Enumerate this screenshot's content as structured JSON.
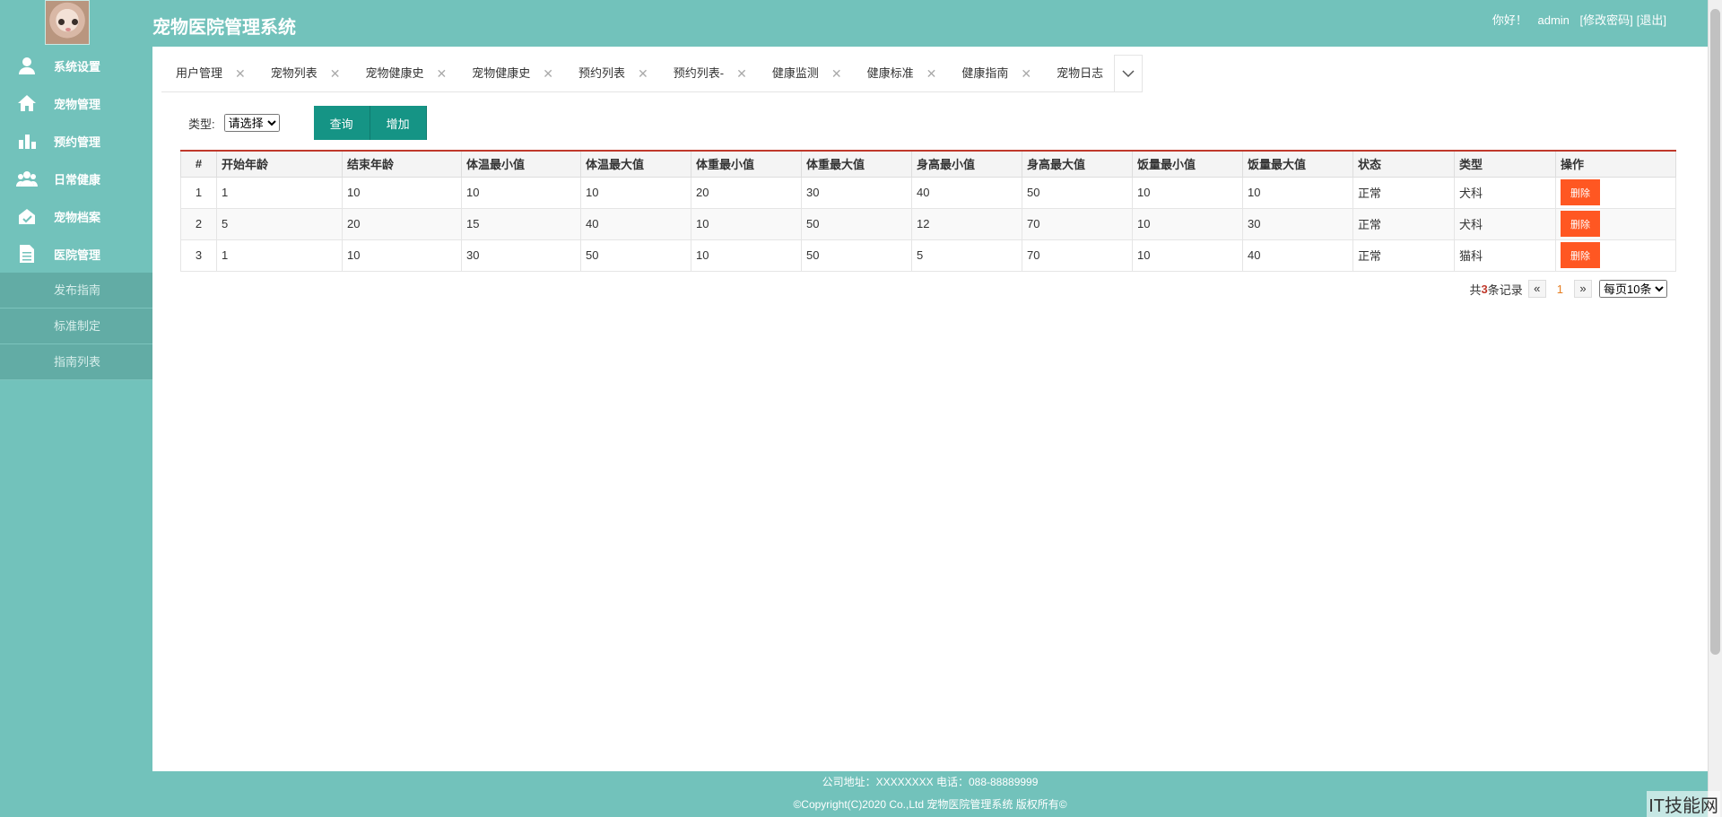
{
  "header": {
    "title": "宠物医院管理系统",
    "greeting": "你好！",
    "username": "admin",
    "change_password": "[修改密码]",
    "logout": "[退出]"
  },
  "sidebar": {
    "items": [
      {
        "label": "系统设置",
        "icon": "user-icon"
      },
      {
        "label": "宠物管理",
        "icon": "home-icon"
      },
      {
        "label": "预约管理",
        "icon": "bar-chart-icon"
      },
      {
        "label": "日常健康",
        "icon": "group-icon"
      },
      {
        "label": "宠物档案",
        "icon": "archive-icon"
      },
      {
        "label": "医院管理",
        "icon": "document-icon"
      }
    ],
    "sub_items": [
      "发布指南",
      "标准制定",
      "指南列表"
    ]
  },
  "tabs": [
    "用户管理",
    "宠物列表",
    "宠物健康史",
    "宠物健康史",
    "预约列表",
    "预约列表-",
    "健康监测",
    "健康标准",
    "健康指南",
    "宠物日志"
  ],
  "filter": {
    "type_label": "类型:",
    "type_select": "请选择",
    "query_button": "查询",
    "add_button": "增加"
  },
  "table": {
    "headers": [
      "#",
      "开始年龄",
      "结束年龄",
      "体温最小值",
      "体温最大值",
      "体重最小值",
      "体重最大值",
      "身高最小值",
      "身高最大值",
      "饭量最小值",
      "饭量最大值",
      "状态",
      "类型",
      "操作"
    ],
    "rows": [
      [
        "1",
        "1",
        "10",
        "10",
        "10",
        "20",
        "30",
        "40",
        "50",
        "10",
        "10",
        "正常",
        "犬科"
      ],
      [
        "2",
        "5",
        "20",
        "15",
        "40",
        "10",
        "50",
        "12",
        "70",
        "10",
        "30",
        "正常",
        "犬科"
      ],
      [
        "3",
        "1",
        "10",
        "30",
        "50",
        "10",
        "50",
        "5",
        "70",
        "10",
        "40",
        "正常",
        "猫科"
      ]
    ],
    "delete_label": "删除"
  },
  "pager": {
    "total_prefix": "共",
    "total_count": "3",
    "total_suffix": "条记录",
    "prev": "«",
    "current": "1",
    "next": "»",
    "page_size": "每页10条"
  },
  "footer": {
    "address": "公司地址：XXXXXXXX 电话：088-88889999",
    "copyright": "©Copyright(C)2020 Co.,Ltd 宠物医院管理系统 版权所有©"
  },
  "watermark": "IT技能网",
  "colors": {
    "theme": "#72c2bb",
    "button": "#159485",
    "delete": "#ff5722",
    "accent": "#c0392b"
  }
}
